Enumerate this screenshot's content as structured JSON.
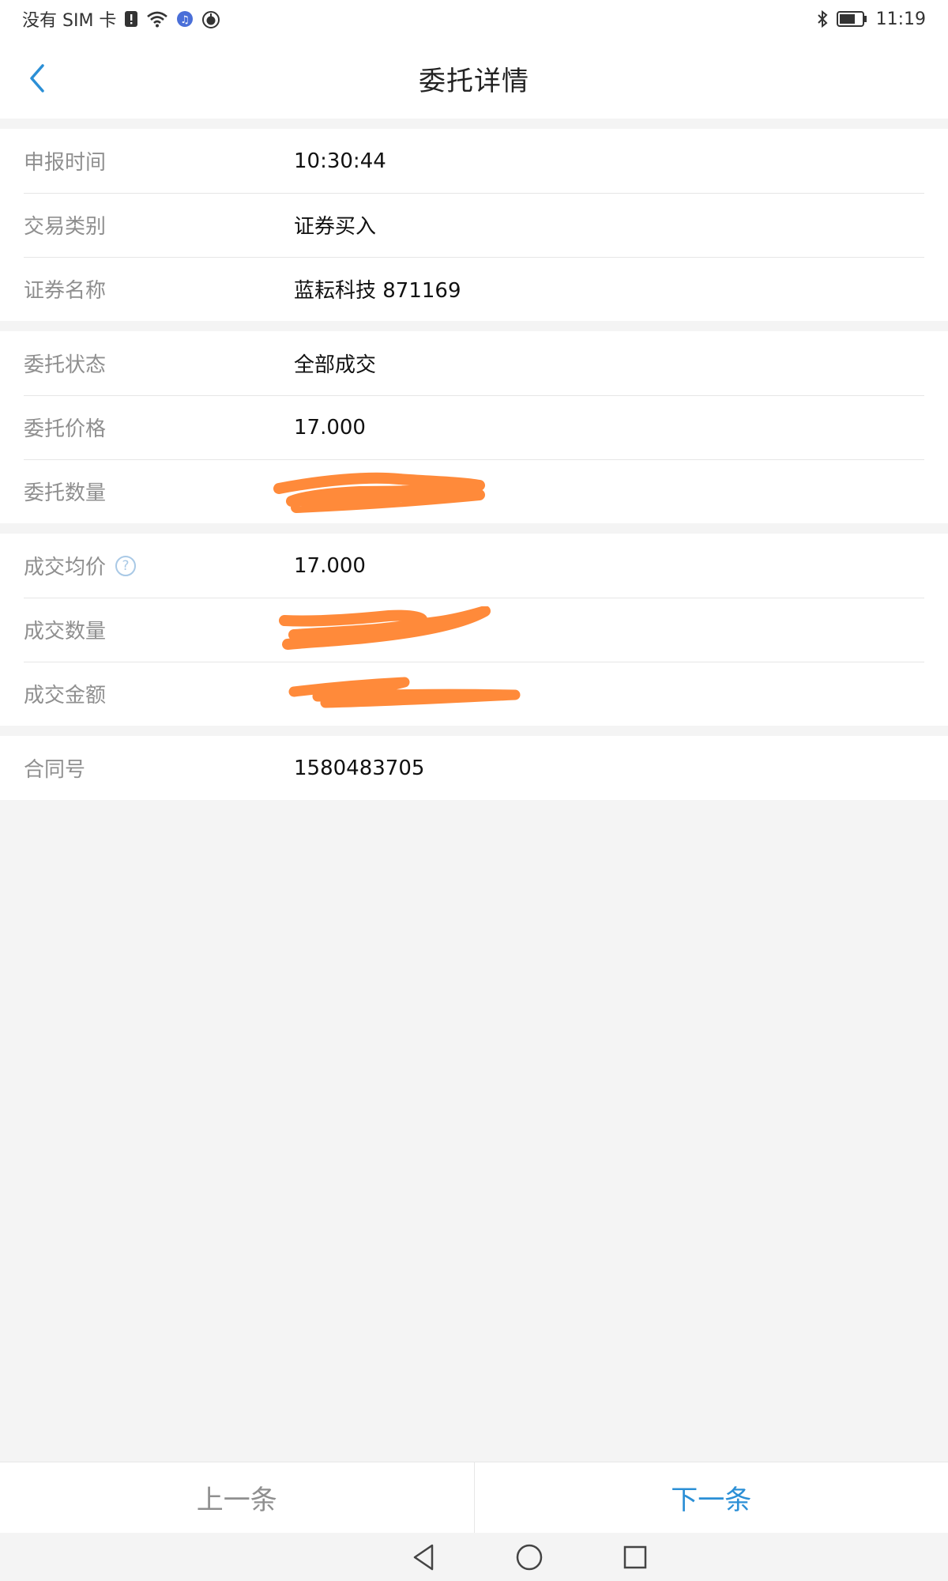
{
  "status_bar": {
    "carrier": "没有 SIM 卡",
    "time": "11:19",
    "icons": [
      "sim-alert-icon",
      "wifi-icon",
      "music-icon",
      "apple-icon",
      "bluetooth-icon",
      "battery-icon"
    ]
  },
  "header": {
    "title": "委托详情",
    "back_icon": "chevron-left-icon"
  },
  "sections": [
    {
      "rows": [
        {
          "label": "申报时间",
          "value": "10:30:44"
        },
        {
          "label": "交易类别",
          "value": "证券买入"
        },
        {
          "label": "证券名称",
          "value": "蓝耘科技 871169"
        }
      ]
    },
    {
      "rows": [
        {
          "label": "委托状态",
          "value": "全部成交"
        },
        {
          "label": "委托价格",
          "value": "17.000"
        },
        {
          "label": "委托数量",
          "value": ""
        }
      ]
    },
    {
      "rows": [
        {
          "label": "成交均价",
          "value": "17.000",
          "help_icon": "?"
        },
        {
          "label": "成交数量",
          "value": ""
        },
        {
          "label": "成交金额",
          "value": ""
        }
      ]
    },
    {
      "rows": [
        {
          "label": "合同号",
          "value": "1580483705"
        }
      ]
    }
  ],
  "redaction_color": "#ff8a3a",
  "accent_color": "#2b8fd6",
  "bottom_bar": {
    "prev_label": "上一条",
    "next_label": "下一条"
  },
  "system_nav": [
    "back-triangle-icon",
    "home-circle-icon",
    "recents-square-icon"
  ]
}
